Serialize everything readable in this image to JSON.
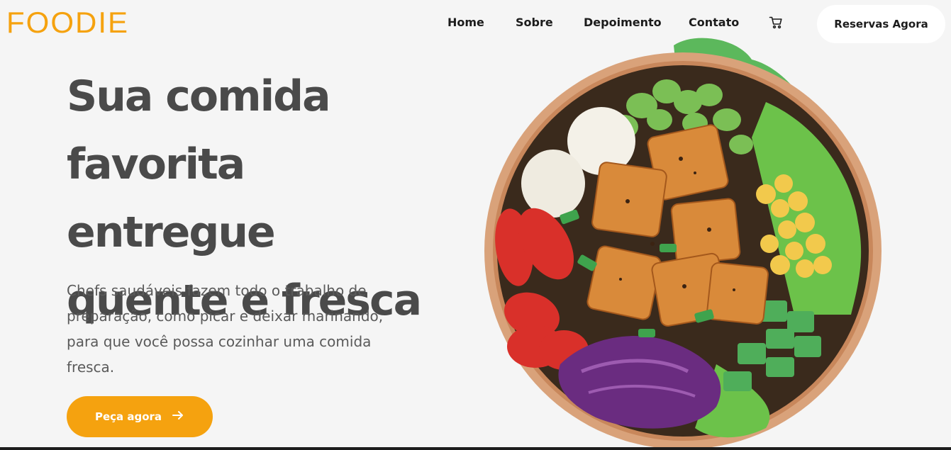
{
  "brand": {
    "logo": "FOODIE",
    "accent": "#f5a20f"
  },
  "nav": {
    "items": [
      {
        "label": "Home"
      },
      {
        "label": "Sobre"
      },
      {
        "label": "Depoimento"
      },
      {
        "label": "Contato"
      }
    ],
    "cart_icon": "cart-icon",
    "reserve_label": "Reservas Agora"
  },
  "hero": {
    "headline_lines": [
      "Sua comida",
      "favorita entregue",
      "quente e fresca"
    ],
    "subtitle": "Chefs saudáveis fazem todo o trabalho de preparação, como picar e deixar marinando, para que você possa cozinhar uma comida fresca.",
    "cta_label": "Peça agora",
    "cta_icon": "arrow-right-icon"
  }
}
